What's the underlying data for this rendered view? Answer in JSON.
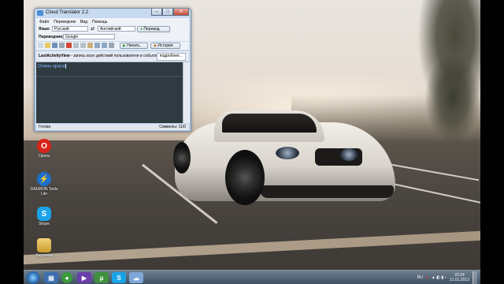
{
  "window": {
    "title": "Cloud Translator 2.2",
    "controls": {
      "minimize": "–",
      "maximize": "□",
      "close": "✕"
    }
  },
  "menu": [
    "Файл",
    "Переводчик",
    "Вид",
    "Помощь"
  ],
  "lang_row": {
    "from_label": "Язык:",
    "from_value": "Русский",
    "to_value": "Английский",
    "translate_button": "Перевод"
  },
  "translator_row": {
    "label": "Переводчик:",
    "value": "Google"
  },
  "toolbar": {
    "speak_button": "Начать",
    "history_button": "История"
  },
  "tab": {
    "title": "LastActivityView",
    "description": " - запись всех действий пользователя и событий",
    "more_button": "подробнее..."
  },
  "editor": {
    "text": "Очень краси"
  },
  "status": {
    "left": "Готово",
    "right": "Символы: 11/0"
  },
  "desktop_icons": [
    {
      "label": "Opera",
      "icon": "opera-icon"
    },
    {
      "label": "DAEMON Tools Lite",
      "icon": "daemon-tools-icon"
    },
    {
      "label": "Skype",
      "icon": "skype-icon"
    },
    {
      "label": "Картинки",
      "icon": "folder-icon"
    }
  ],
  "taskbar": {
    "lang": "RU",
    "time": "22:24",
    "date": "21.01.2013"
  },
  "colors": {
    "editor_bg": "#2f3b40",
    "editor_text": "#7fb6ff",
    "titlebar": "#c9dbef"
  }
}
